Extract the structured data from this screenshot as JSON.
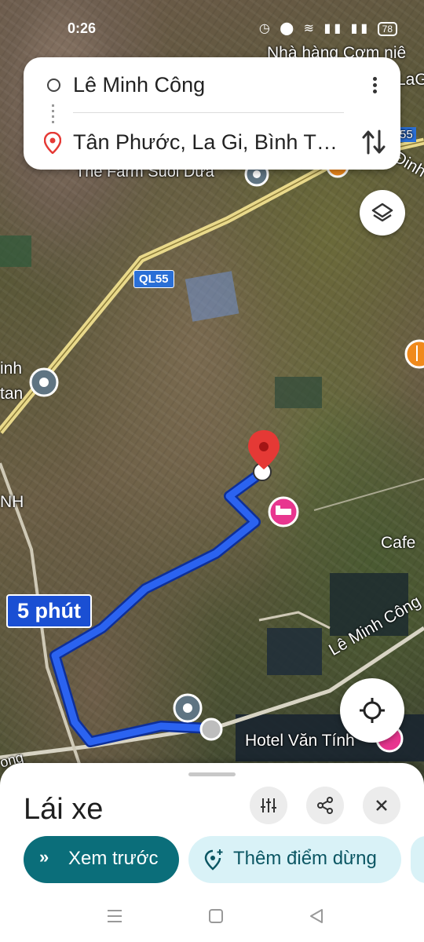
{
  "status_bar": {
    "time": "0:26",
    "battery": "78"
  },
  "search": {
    "origin": "Lê Minh Công",
    "destination": "Tân Phước, La Gi, Bình Th..."
  },
  "map": {
    "labels": {
      "restaurant": "Nhà hàng Cơm niê",
      "top_right": "LaG",
      "farm": "The Farm Suối Dừa",
      "road_num": "55",
      "dinh": "Đinh",
      "inh": "inh",
      "tan": "tan",
      "nh": "NH",
      "cafe": "Cafe",
      "street": "Lê Minh Công",
      "hotel": "Hotel Văn Tính",
      "ong": "ong"
    },
    "road_shield": "QL55",
    "eta": "5 phút"
  },
  "sheet": {
    "mode_title": "Lái xe",
    "preview_label": "Xem trước",
    "add_stop_label": "Thêm điểm dừng"
  },
  "colors": {
    "route": "#1a4fd3",
    "accent": "#0b6e7a",
    "pin": "#e53935",
    "hotel_pin": "#e8368f"
  }
}
